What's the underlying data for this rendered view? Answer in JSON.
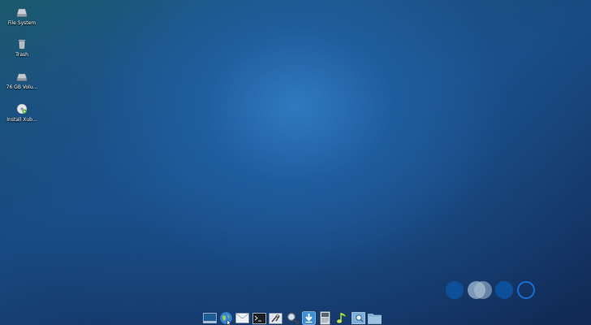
{
  "desktop": {
    "icons": [
      {
        "label": "File System",
        "icon": "drive-icon"
      },
      {
        "label": "Trash",
        "icon": "trash-icon"
      },
      {
        "label": "76 GB Volu...",
        "icon": "volume-icon"
      },
      {
        "label": "Install Xub...",
        "icon": "install-disc-icon"
      }
    ]
  },
  "workspaces": {
    "count": 4,
    "colors": {
      "filled": "#0e4f9a",
      "active_overlay": "#8fa9c6",
      "ring": "#1a6fd6"
    }
  },
  "dock": {
    "items": [
      "desktop-icon",
      "web-browser-icon",
      "mail-icon",
      "terminal-icon",
      "settings-icon",
      "search-icon",
      "download-icon",
      "text-editor-icon",
      "music-player-icon",
      "image-viewer-icon",
      "file-manager-icon"
    ]
  }
}
